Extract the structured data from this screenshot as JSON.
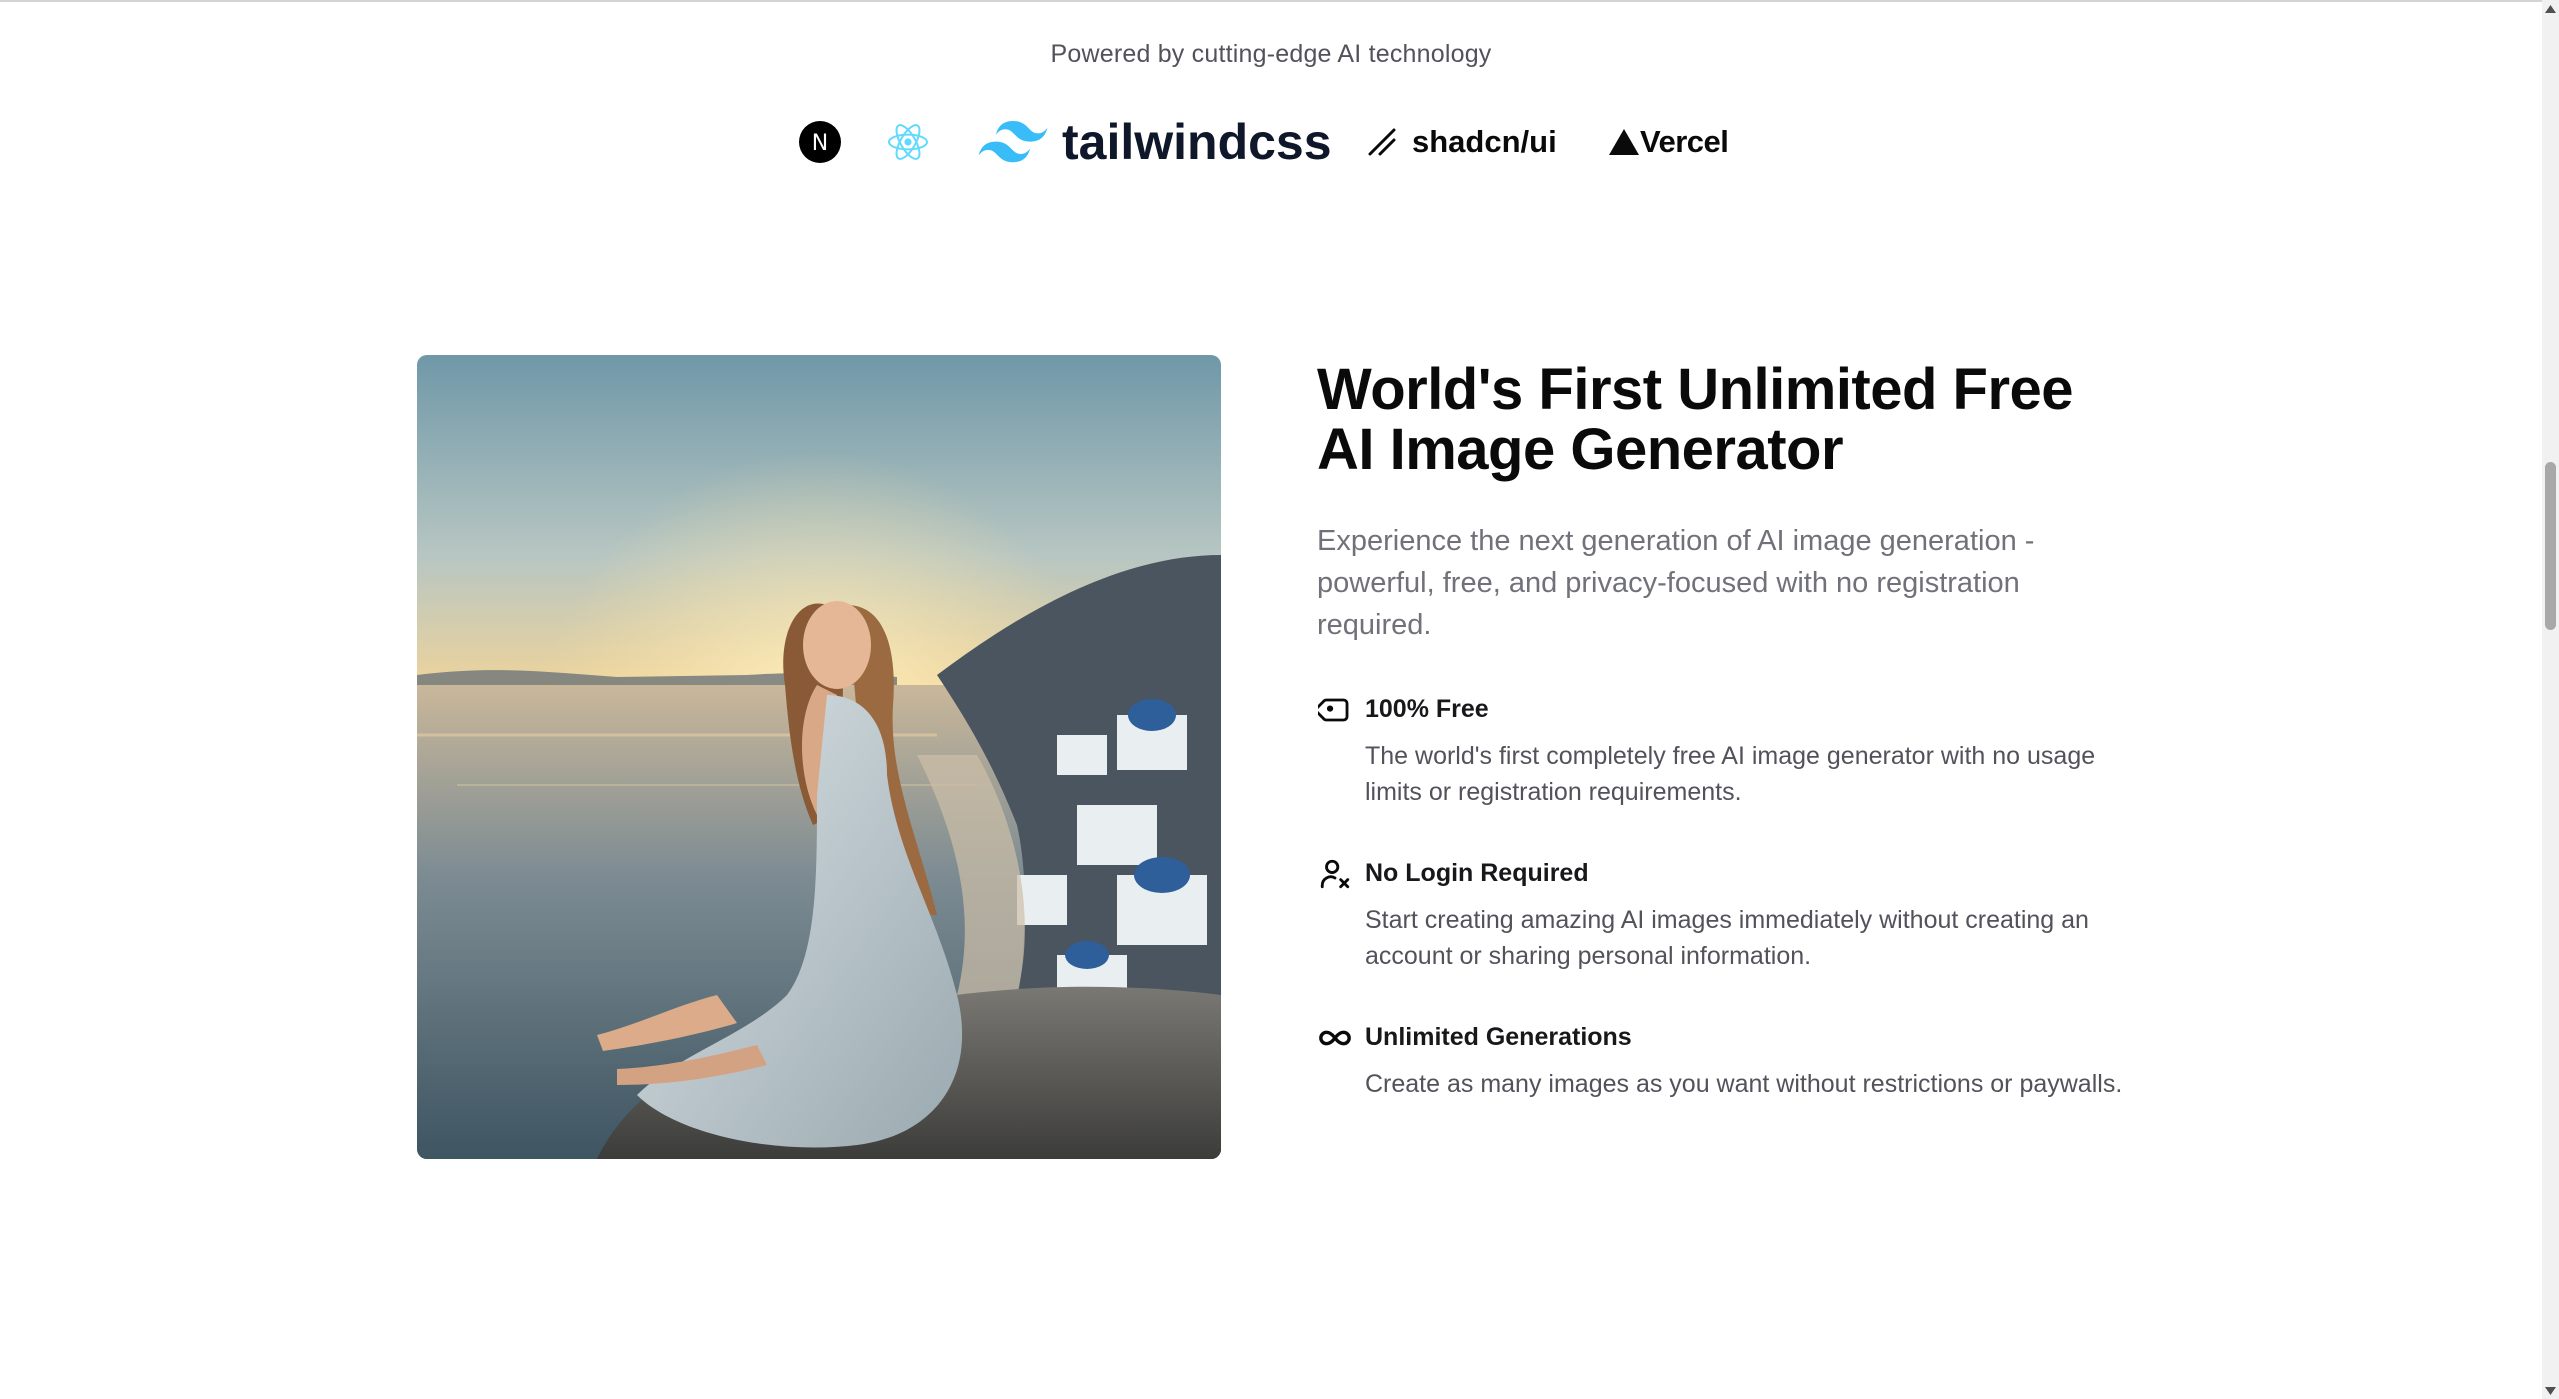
{
  "powered_by": {
    "text": "Powered by cutting-edge AI technology",
    "logos": [
      {
        "name": "nextjs",
        "icon": "nextjs-logo-icon",
        "letter": "N"
      },
      {
        "name": "react",
        "icon": "react-logo-icon"
      },
      {
        "name": "tailwindcss",
        "icon": "tailwind-logo-icon",
        "wordmark": "tailwindcss"
      },
      {
        "name": "shadcn",
        "icon": "shadcn-logo-icon",
        "wordmark": "shadcn/ui"
      },
      {
        "name": "vercel",
        "icon": "vercel-triangle-icon",
        "wordmark": "Vercel"
      }
    ]
  },
  "hero": {
    "headline": "World's First Unlimited Free AI Image Generator",
    "subtitle": "Experience the next generation of AI image generation - powerful, free, and privacy-focused with no registration required.",
    "image_icon": "woman-by-sea-photo"
  },
  "features": [
    {
      "icon": "tag-icon",
      "title": "100% Free",
      "description": "The world's first completely free AI image generator with no usage limits or registration requirements."
    },
    {
      "icon": "user-x-icon",
      "title": "No Login Required",
      "description": "Start creating amazing AI images immediately without creating an account or sharing personal information."
    },
    {
      "icon": "infinity-icon",
      "title": "Unlimited Generations",
      "description": "Create as many images as you want without restrictions or paywalls."
    }
  ],
  "colors": {
    "tailwind": "#38bdf8",
    "react": "#61dafb",
    "heading": "#0a0a0a",
    "muted": "#71717a"
  }
}
